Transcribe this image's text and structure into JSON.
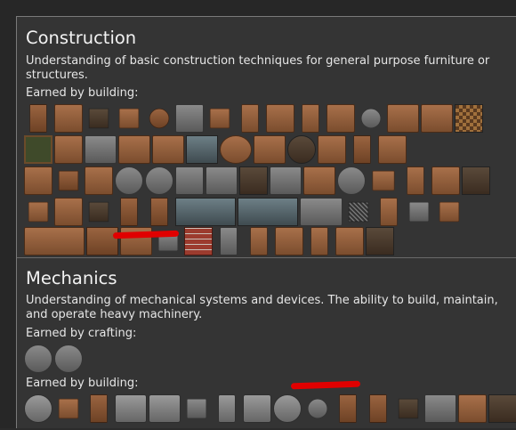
{
  "sections": [
    {
      "title": "Construction",
      "description": "Understanding of basic construction techniques for general purpose furniture or structures.",
      "earned_building_label": "Earned by building:"
    },
    {
      "title": "Mechanics",
      "description": "Understanding of mechanical systems and devices. The ability to build, maintain, and operate heavy machinery.",
      "earned_crafting_label": "Earned by crafting:",
      "earned_building_label": "Earned by building:"
    }
  ],
  "colors": {
    "highlight_mark": "#e00000",
    "panel_bg": "#343434",
    "text": "#e6e6e6"
  }
}
